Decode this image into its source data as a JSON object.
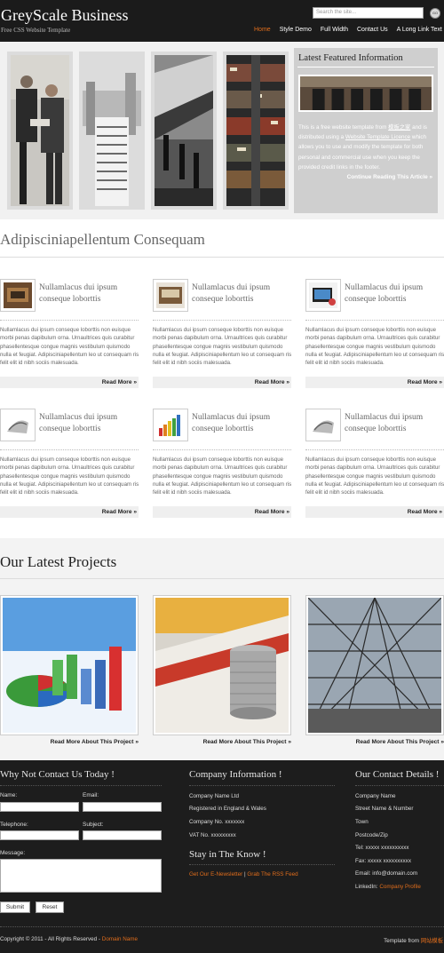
{
  "header": {
    "site_title": "GreyScale Business",
    "tagline": "Free CSS Website Template",
    "search_placeholder": "Search the site...",
    "search_button": "GO",
    "nav": [
      "Home",
      "Style Demo",
      "Full Width",
      "Contact Us",
      "A Long Link Text"
    ]
  },
  "featured": {
    "title": "Latest Featured Information",
    "text_before": "This is a free website template from",
    "site_link": "模板之家",
    "text_mid": "and is distributed using a",
    "license_link": "Website Template Licence",
    "text_after": "which allows you to use and modify the template for both personal and commercial use when you keep the provided credit links in the footer.",
    "more": "Continue Reading This Article »"
  },
  "services": {
    "heading": "Adipisciniapellentum Consequam",
    "item_title": "Nullamlacus dui ipsum conseque loborttis",
    "item_body": "Nullamlacus dui ipsum conseque loborttis non euisque morbi penas dapibulum orna. Urnaultrices quis curabitur phasellentesque congue magnis vestibulum quismodo nulla et feugiat. Adipisciniapellentum leo ut consequam ris felit elit id nibh sociis malesuada.",
    "more": "Read More »"
  },
  "projects": {
    "heading": "Our Latest Projects",
    "more": "Read More About This Project »"
  },
  "footer": {
    "contact_heading": "Why Not Contact Us Today !",
    "name_label": "Name:",
    "email_label": "Email:",
    "telephone_label": "Telephone:",
    "subject_label": "Subject:",
    "message_label": "Message:",
    "submit": "Submit",
    "reset": "Reset",
    "company_heading": "Company Information !",
    "company_lines": [
      "Company Name Ltd",
      "Registered in England & Wales",
      "Company No. xxxxxxx",
      "VAT No. xxxxxxxxx"
    ],
    "know_heading": "Stay in The Know !",
    "newsletter_link": "Get Our E-Newsletter",
    "separator": "|",
    "rss_link": "Grab The RSS Feed",
    "details_heading": "Our Contact Details !",
    "details_lines": [
      "Company Name",
      "Street Name & Number",
      "Town",
      "Postcode/Zip",
      "Tel: xxxxx xxxxxxxxxx",
      "Fax: xxxxx xxxxxxxxxx",
      "Email: info@domain.com"
    ],
    "linkedin_label": "LinkedIn:",
    "linkedin_link": "Company Profile",
    "copyright": "Copyright © 2011 - All Rights Reserved -",
    "domain_link": "Domain Name",
    "template_from": "Template from",
    "template_link": "网站模板"
  },
  "colors": {
    "accent": "#e06d1c",
    "dark": "#1b1b1b",
    "panel": "#cfcfcf"
  }
}
